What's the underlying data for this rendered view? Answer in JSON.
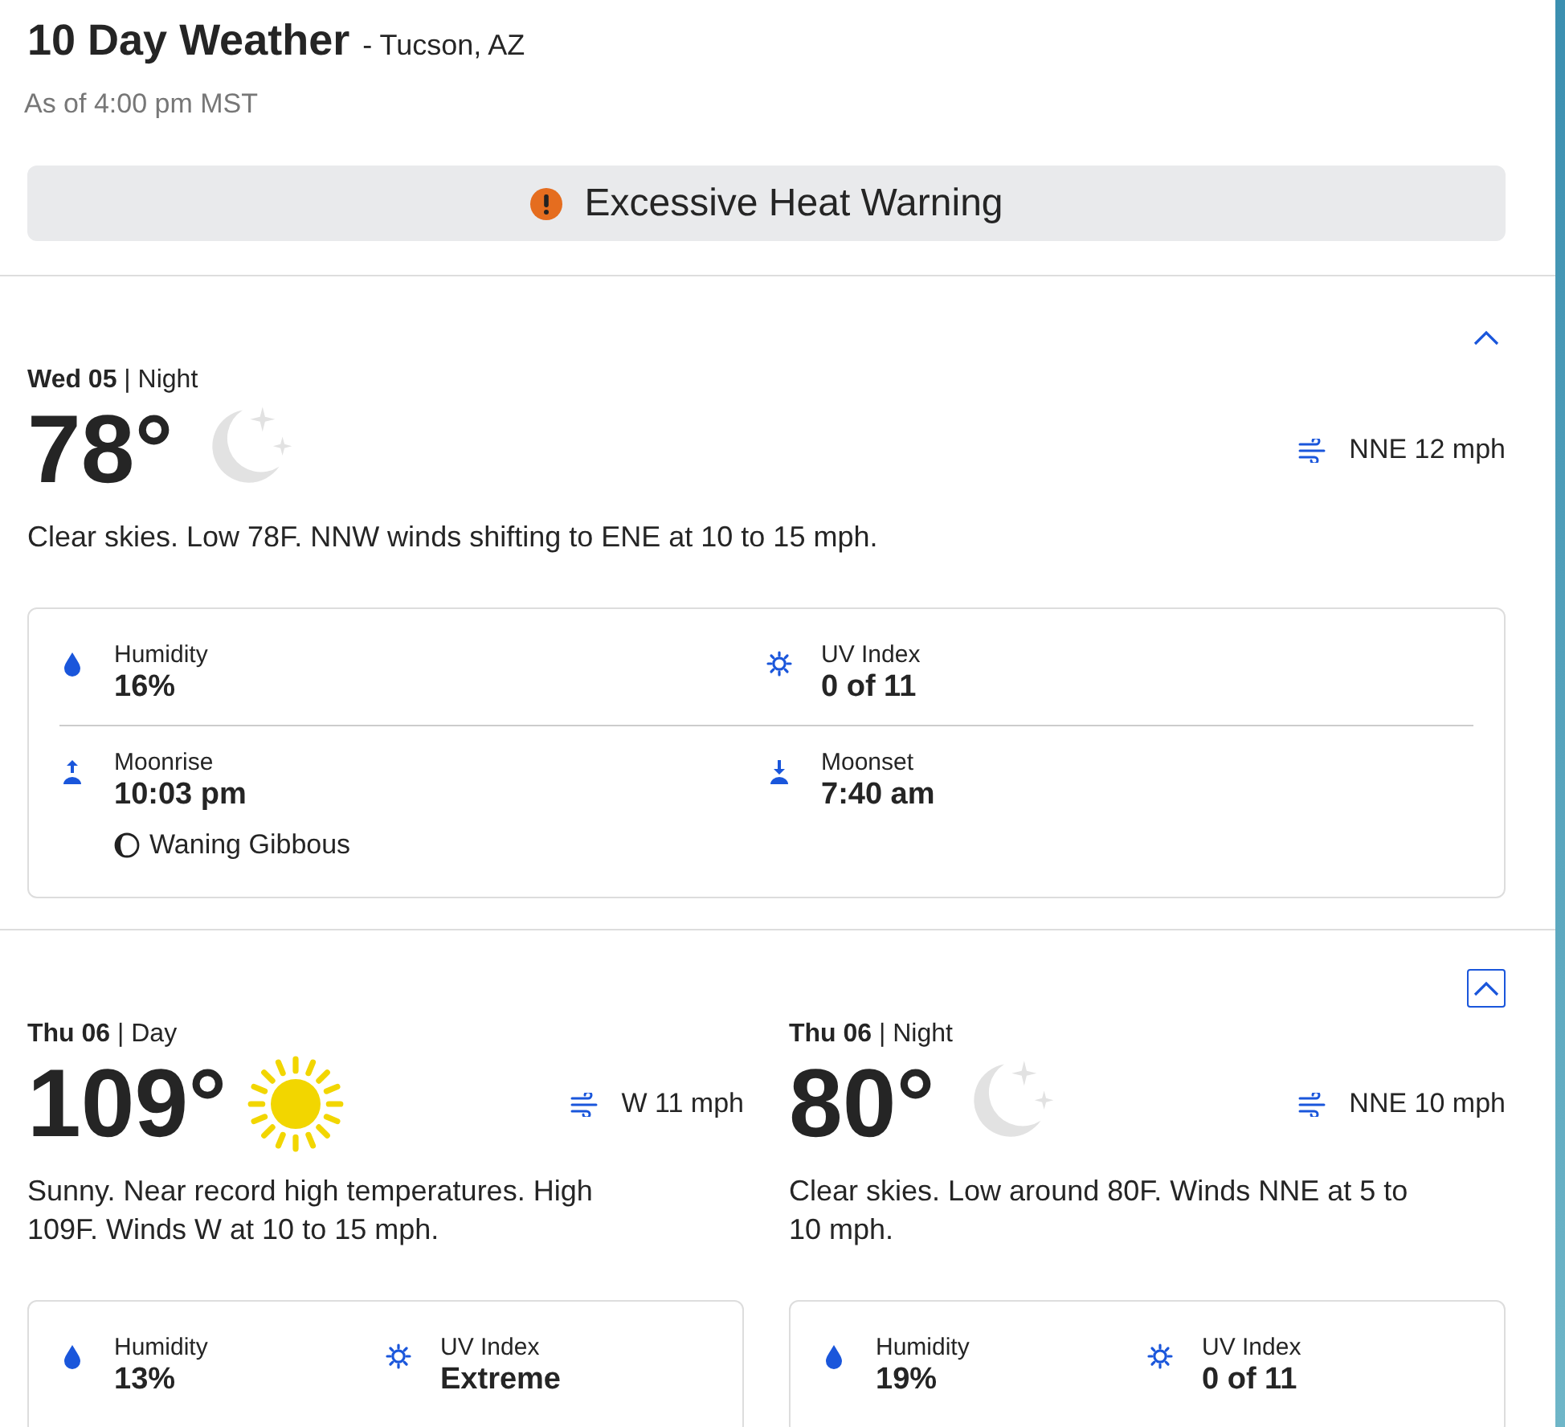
{
  "header": {
    "title": "10 Day Weather",
    "location": "- Tucson, AZ",
    "as_of": "As of 4:00 pm MST"
  },
  "alert": {
    "text": "Excessive Heat Warning"
  },
  "days": [
    {
      "expanded": true,
      "focused": false,
      "periods": [
        {
          "day": "Wed 05",
          "part": "| Night",
          "temp": "78°",
          "kind": "moon",
          "wind": "NNE 12 mph",
          "narrative": "Clear skies. Low 78F. NNW winds shifting to ENE at 10 to 15 mph.",
          "details": [
            [
              {
                "kind": "humidity",
                "label": "Humidity",
                "value": "16%"
              },
              {
                "kind": "uv",
                "label": "UV Index",
                "value": "0 of 11"
              }
            ],
            [
              {
                "kind": "moonrise",
                "label": "Moonrise",
                "value": "10:03 pm",
                "phase": "Waning Gibbous"
              },
              {
                "kind": "moonset",
                "label": "Moonset",
                "value": "7:40 am"
              }
            ]
          ]
        }
      ]
    },
    {
      "expanded": true,
      "focused": true,
      "periods": [
        {
          "day": "Thu 06",
          "part": "| Day",
          "temp": "109°",
          "kind": "sun",
          "wind": "W 11 mph",
          "narrative": "Sunny. Near record high temperatures. High 109F. Winds W at 10 to 15 mph.",
          "details": [
            [
              {
                "kind": "humidity",
                "label": "Humidity",
                "value": "13%"
              },
              {
                "kind": "uv",
                "label": "UV Index",
                "value": "Extreme"
              }
            ]
          ]
        },
        {
          "day": "Thu 06",
          "part": "| Night",
          "temp": "80°",
          "kind": "moon",
          "wind": "NNE 10 mph",
          "narrative": "Clear skies. Low around 80F. Winds NNE at 5 to 10 mph.",
          "details": [
            [
              {
                "kind": "humidity",
                "label": "Humidity",
                "value": "19%"
              },
              {
                "kind": "uv",
                "label": "UV Index",
                "value": "0 of 11"
              }
            ]
          ]
        }
      ]
    }
  ]
}
